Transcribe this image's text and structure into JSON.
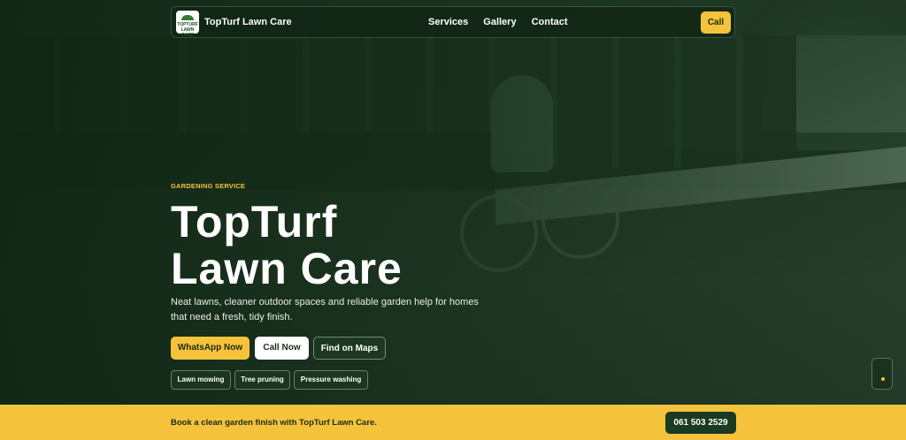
{
  "nav": {
    "logo_text": "TOPTURF LAWN CARE",
    "brand": "TopTurf Lawn Care",
    "links": [
      "Services",
      "Gallery",
      "Contact"
    ],
    "call_label": "Call"
  },
  "hero": {
    "eyebrow": "GARDENING SERVICE",
    "title_line1": "TopTurf",
    "title_line2": "Lawn Care",
    "description": "Neat lawns, cleaner outdoor spaces and reliable garden help for homes that need a fresh, tidy finish.",
    "buttons": {
      "whatsapp": "WhatsApp Now",
      "call": "Call Now",
      "maps": "Find on Maps"
    },
    "chips": [
      "Lawn mowing",
      "Tree pruning",
      "Pressure washing"
    ]
  },
  "bottom_bar": {
    "text": "Book a clean garden finish with TopTurf Lawn Care.",
    "phone": "061 503 2529"
  },
  "colors": {
    "accent": "#f5c33b",
    "dark_green": "#1b3a22"
  }
}
